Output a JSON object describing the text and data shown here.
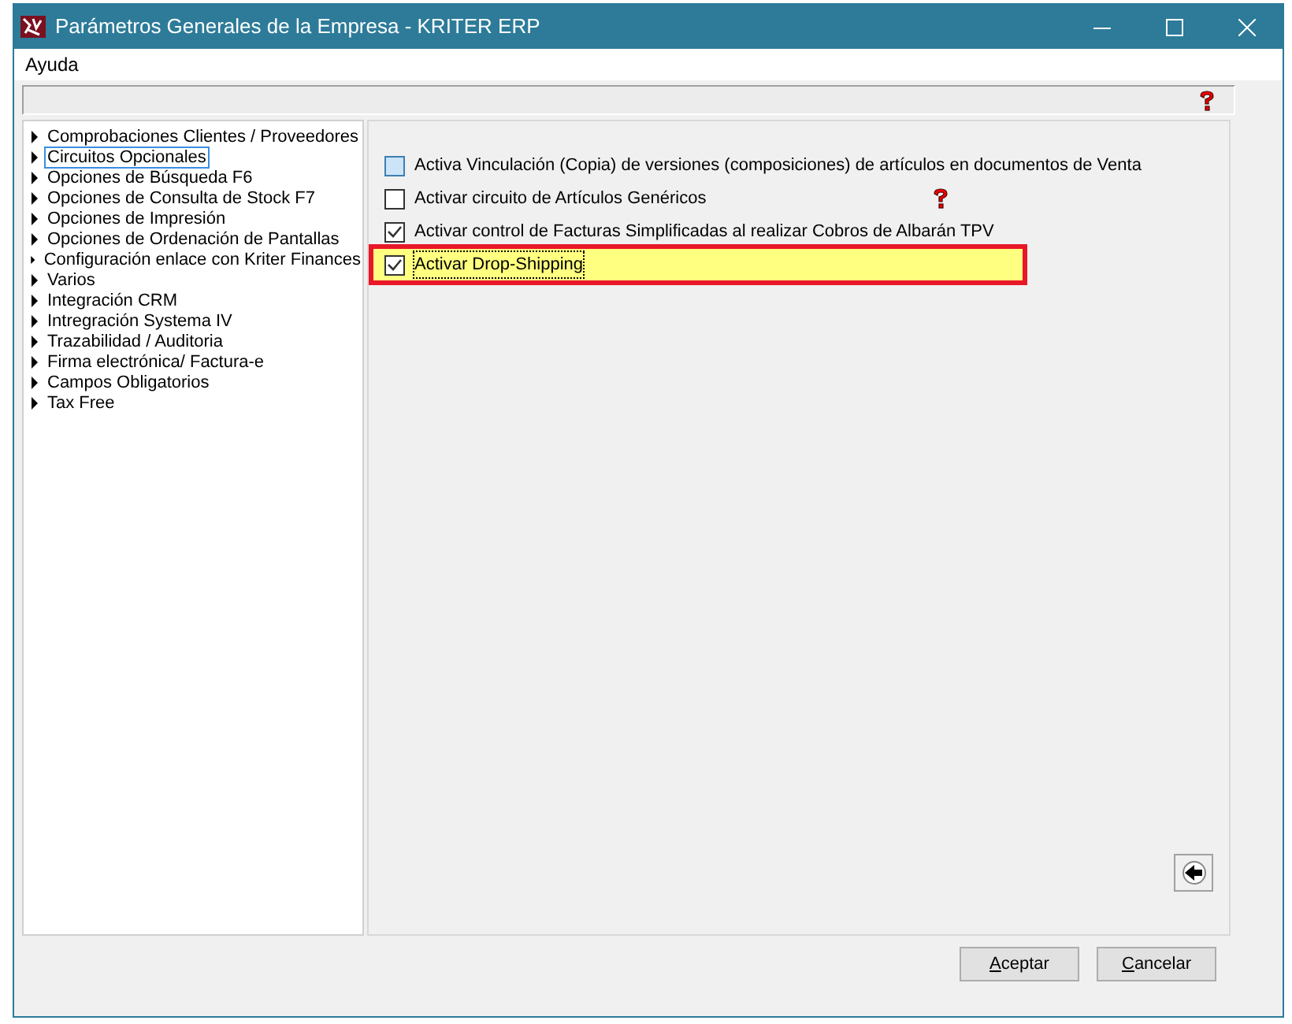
{
  "window": {
    "title": "Parámetros Generales de la Empresa - KRITER ERP"
  },
  "menu": [
    {
      "label": "Ayuda"
    }
  ],
  "tree": [
    {
      "label": "Comprobaciones Clientes / Proveedores",
      "selected": false
    },
    {
      "label": "Circuitos Opcionales",
      "selected": true
    },
    {
      "label": "Opciones de Búsqueda F6",
      "selected": false
    },
    {
      "label": "Opciones de Consulta de Stock F7",
      "selected": false
    },
    {
      "label": "Opciones de Impresión",
      "selected": false
    },
    {
      "label": "Opciones de Ordenación de Pantallas",
      "selected": false
    },
    {
      "label": "Configuración enlace con Kriter Finances",
      "selected": false
    },
    {
      "label": "Varios",
      "selected": false
    },
    {
      "label": "Integración CRM",
      "selected": false
    },
    {
      "label": "Intregración Systema IV",
      "selected": false
    },
    {
      "label": "Trazabilidad / Auditoria",
      "selected": false
    },
    {
      "label": "Firma electrónica/ Factura-e",
      "selected": false
    },
    {
      "label": "Campos Obligatorios",
      "selected": false
    },
    {
      "label": "Tax Free",
      "selected": false
    }
  ],
  "options": [
    {
      "label": "Activa Vinculación (Copia) de versiones (composiciones) de artículos en documentos de Venta",
      "checked": false,
      "hovered": true,
      "highlighted": false,
      "help": false
    },
    {
      "label": "Activar circuito de Artículos Genéricos",
      "checked": false,
      "hovered": false,
      "highlighted": false,
      "help": true
    },
    {
      "label": "Activar control de Facturas Simplificadas al realizar Cobros de Albarán TPV",
      "checked": true,
      "hovered": false,
      "highlighted": false,
      "help": false
    },
    {
      "label": "Activar Drop-Shipping",
      "checked": true,
      "hovered": false,
      "highlighted": true,
      "help": false
    }
  ],
  "buttons": [
    {
      "label": "Aceptar"
    },
    {
      "label": "Cancelar"
    }
  ]
}
